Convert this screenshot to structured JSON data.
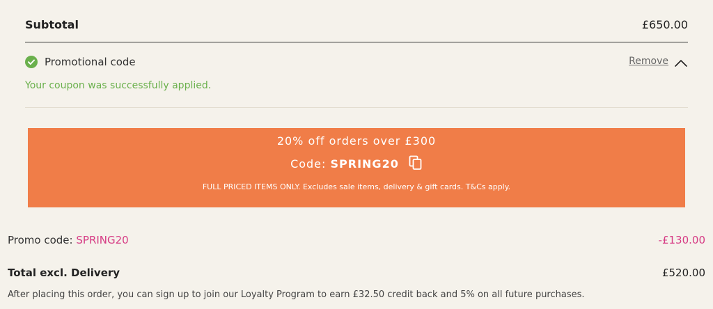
{
  "summary": {
    "subtotal_label": "Subtotal",
    "subtotal_value": "£650.00"
  },
  "promo": {
    "label": "Promotional code",
    "remove_label": "Remove",
    "success_message": "Your coupon was successfully applied."
  },
  "banner": {
    "offer_text": "20% off orders over £300",
    "code_prefix": "Code:",
    "code_value": "SPRING20",
    "terms": "FULL PRICED ITEMS ONLY. Excludes sale items, delivery & gift cards. T&Cs apply."
  },
  "applied": {
    "label": "Promo code:",
    "code": "SPRING20",
    "discount": "-£130.00"
  },
  "total": {
    "label": "Total excl. Delivery",
    "value": "£520.00"
  },
  "loyalty": {
    "note": "After placing this order, you can sign up to join our Loyalty Program to earn £32.50 credit back and 5% on all future purchases."
  },
  "colors": {
    "background": "#f5f2eb",
    "banner": "#f07d48",
    "success_green": "#6ab04c",
    "discount_pink": "#d63b84"
  },
  "icons": {
    "success": "check-circle-icon",
    "collapse": "chevron-up-icon",
    "copy": "copy-icon"
  }
}
